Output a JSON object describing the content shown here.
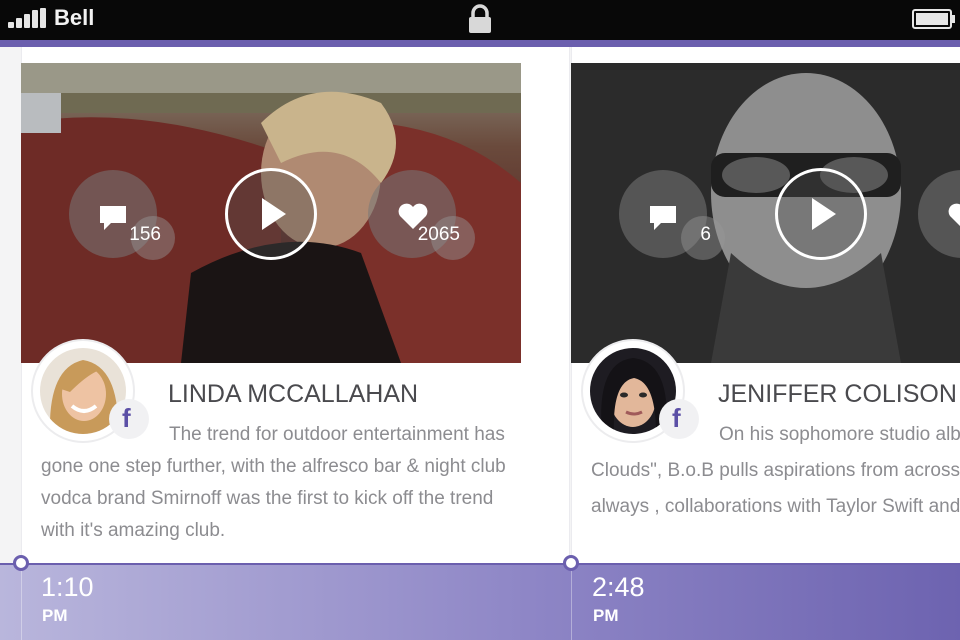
{
  "status_bar": {
    "carrier": "Bell",
    "signal_icon": "signal-bars-icon",
    "lock_icon": "lock-icon",
    "battery_icon": "battery-full-icon"
  },
  "colors": {
    "accent": "#6b5fae",
    "facebook": "#5b4fa6",
    "text_primary": "#4a4a4e",
    "text_secondary": "#8c8c90"
  },
  "cards": [
    {
      "author": "LINDA MCCALLAHAN",
      "comments": "156",
      "likes": "2065",
      "social_icon": "facebook-icon",
      "text_lines": [
        "The trend for outdoor entertainment has",
        "gone one step further, with the alfresco bar & night club",
        "vodca brand Smirnoff was the first to kick off the trend",
        "with it's amazing club."
      ],
      "time": "1:10",
      "ampm": "PM"
    },
    {
      "author": "JENIFFER COLISON",
      "comments": "6",
      "social_icon": "facebook-icon",
      "text_lines": [
        "On his sophomore studio alb",
        "Clouds\", B.o.B pulls aspirations from across a",
        "always , collaborations with Taylor Swift and"
      ],
      "time": "2:48",
      "ampm": "PM"
    }
  ]
}
